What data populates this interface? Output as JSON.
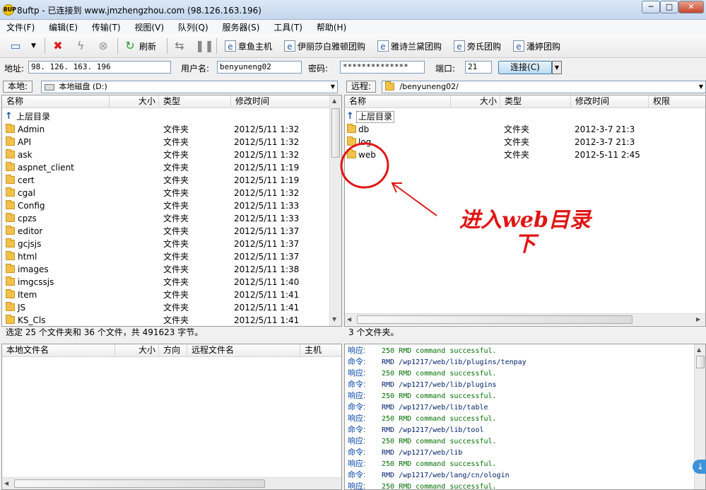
{
  "window": {
    "title": "8uftp - 已连接到 www.jmzhengzhou.com (98.126.163.196)",
    "app_icon_text": "8UP",
    "minimize": "─",
    "maximize": "□",
    "close": "✕"
  },
  "menu": [
    "文件(F)",
    "编辑(E)",
    "传输(T)",
    "视图(V)",
    "队列(Q)",
    "服务器(S)",
    "工具(T)",
    "帮助(H)"
  ],
  "toolbar": {
    "refresh_label": "刷新",
    "bookmarks": [
      "章鱼主机",
      "伊丽莎白雅顿团购",
      "雅诗兰黛团购",
      "旁氏团购",
      "潘婷团购"
    ]
  },
  "connection": {
    "address_label": "地址:",
    "address_value": "98. 126. 163. 196",
    "username_label": "用户名:",
    "username_value": "benyuneng02",
    "password_label": "密码:",
    "password_value": "**************",
    "port_label": "端口:",
    "port_value": "21",
    "connect_label": "连接(C)"
  },
  "local": {
    "path_label": "本地:",
    "path_value": "本地磁盘 (D:)",
    "columns": [
      "名称",
      "大小",
      "类型",
      "修改时间"
    ],
    "up_label": "上层目录",
    "files": [
      {
        "name": "Admin",
        "type": "文件夹",
        "modified": "2012/5/11 1:32"
      },
      {
        "name": "API",
        "type": "文件夹",
        "modified": "2012/5/11 1:32"
      },
      {
        "name": "ask",
        "type": "文件夹",
        "modified": "2012/5/11 1:32"
      },
      {
        "name": "aspnet_client",
        "type": "文件夹",
        "modified": "2012/5/11 1:19"
      },
      {
        "name": "cert",
        "type": "文件夹",
        "modified": "2012/5/11 1:19"
      },
      {
        "name": "cgal",
        "type": "文件夹",
        "modified": "2012/5/11 1:32"
      },
      {
        "name": "Config",
        "type": "文件夹",
        "modified": "2012/5/11 1:33"
      },
      {
        "name": "cpzs",
        "type": "文件夹",
        "modified": "2012/5/11 1:33"
      },
      {
        "name": "editor",
        "type": "文件夹",
        "modified": "2012/5/11 1:37"
      },
      {
        "name": "gcjsjs",
        "type": "文件夹",
        "modified": "2012/5/11 1:37"
      },
      {
        "name": "html",
        "type": "文件夹",
        "modified": "2012/5/11 1:37"
      },
      {
        "name": "images",
        "type": "文件夹",
        "modified": "2012/5/11 1:38"
      },
      {
        "name": "imgcssjs",
        "type": "文件夹",
        "modified": "2012/5/11 1:40"
      },
      {
        "name": "Item",
        "type": "文件夹",
        "modified": "2012/5/11 1:41"
      },
      {
        "name": "JS",
        "type": "文件夹",
        "modified": "2012/5/11 1:41"
      },
      {
        "name": "KS_Cls",
        "type": "文件夹",
        "modified": "2012/5/11 1:41"
      }
    ],
    "status": "选定 25 个文件夹和 36 个文件，共 491623 字节。"
  },
  "remote": {
    "path_label": "远程:",
    "path_value": "/benyuneng02/",
    "columns": [
      "名称",
      "大小",
      "类型",
      "修改时间",
      "权限"
    ],
    "up_label": "上层目录",
    "files": [
      {
        "name": "db",
        "type": "文件夹",
        "modified": "2012-3-7 21:3"
      },
      {
        "name": "log",
        "type": "文件夹",
        "modified": "2012-3-7 21:3"
      },
      {
        "name": "web",
        "type": "文件夹",
        "modified": "2012-5-11 2:45"
      }
    ],
    "status": "3 个文件夹。"
  },
  "queue": {
    "columns": [
      "本地文件名",
      "大小",
      "方向",
      "远程文件名",
      "主机"
    ]
  },
  "log": [
    {
      "label": "响应:",
      "text": "250 RMD command successful.",
      "kind": "resp"
    },
    {
      "label": "命令:",
      "text": "RMD /wp1217/web/lib/plugins/tenpay",
      "kind": "cmd"
    },
    {
      "label": "响应:",
      "text": "250 RMD command successful.",
      "kind": "resp"
    },
    {
      "label": "命令:",
      "text": "RMD /wp1217/web/lib/plugins",
      "kind": "cmd"
    },
    {
      "label": "响应:",
      "text": "250 RMD command successful.",
      "kind": "resp"
    },
    {
      "label": "命令:",
      "text": "RMD /wp1217/web/lib/table",
      "kind": "cmd"
    },
    {
      "label": "响应:",
      "text": "250 RMD command successful.",
      "kind": "resp"
    },
    {
      "label": "命令:",
      "text": "RMD /wp1217/web/lib/tool",
      "kind": "cmd"
    },
    {
      "label": "响应:",
      "text": "250 RMD command successful.",
      "kind": "resp"
    },
    {
      "label": "命令:",
      "text": "RMD /wp1217/web/lib",
      "kind": "cmd"
    },
    {
      "label": "响应:",
      "text": "250 RMD command successful.",
      "kind": "resp"
    },
    {
      "label": "命令:",
      "text": "RMD /wp1217/web/lang/cn/ologin",
      "kind": "cmd"
    },
    {
      "label": "响应:",
      "text": "250 RMD command successful.",
      "kind": "resp"
    }
  ],
  "annotation": {
    "text_line1": "进入web目录",
    "text_line2": "下",
    "color": "#e01515"
  }
}
